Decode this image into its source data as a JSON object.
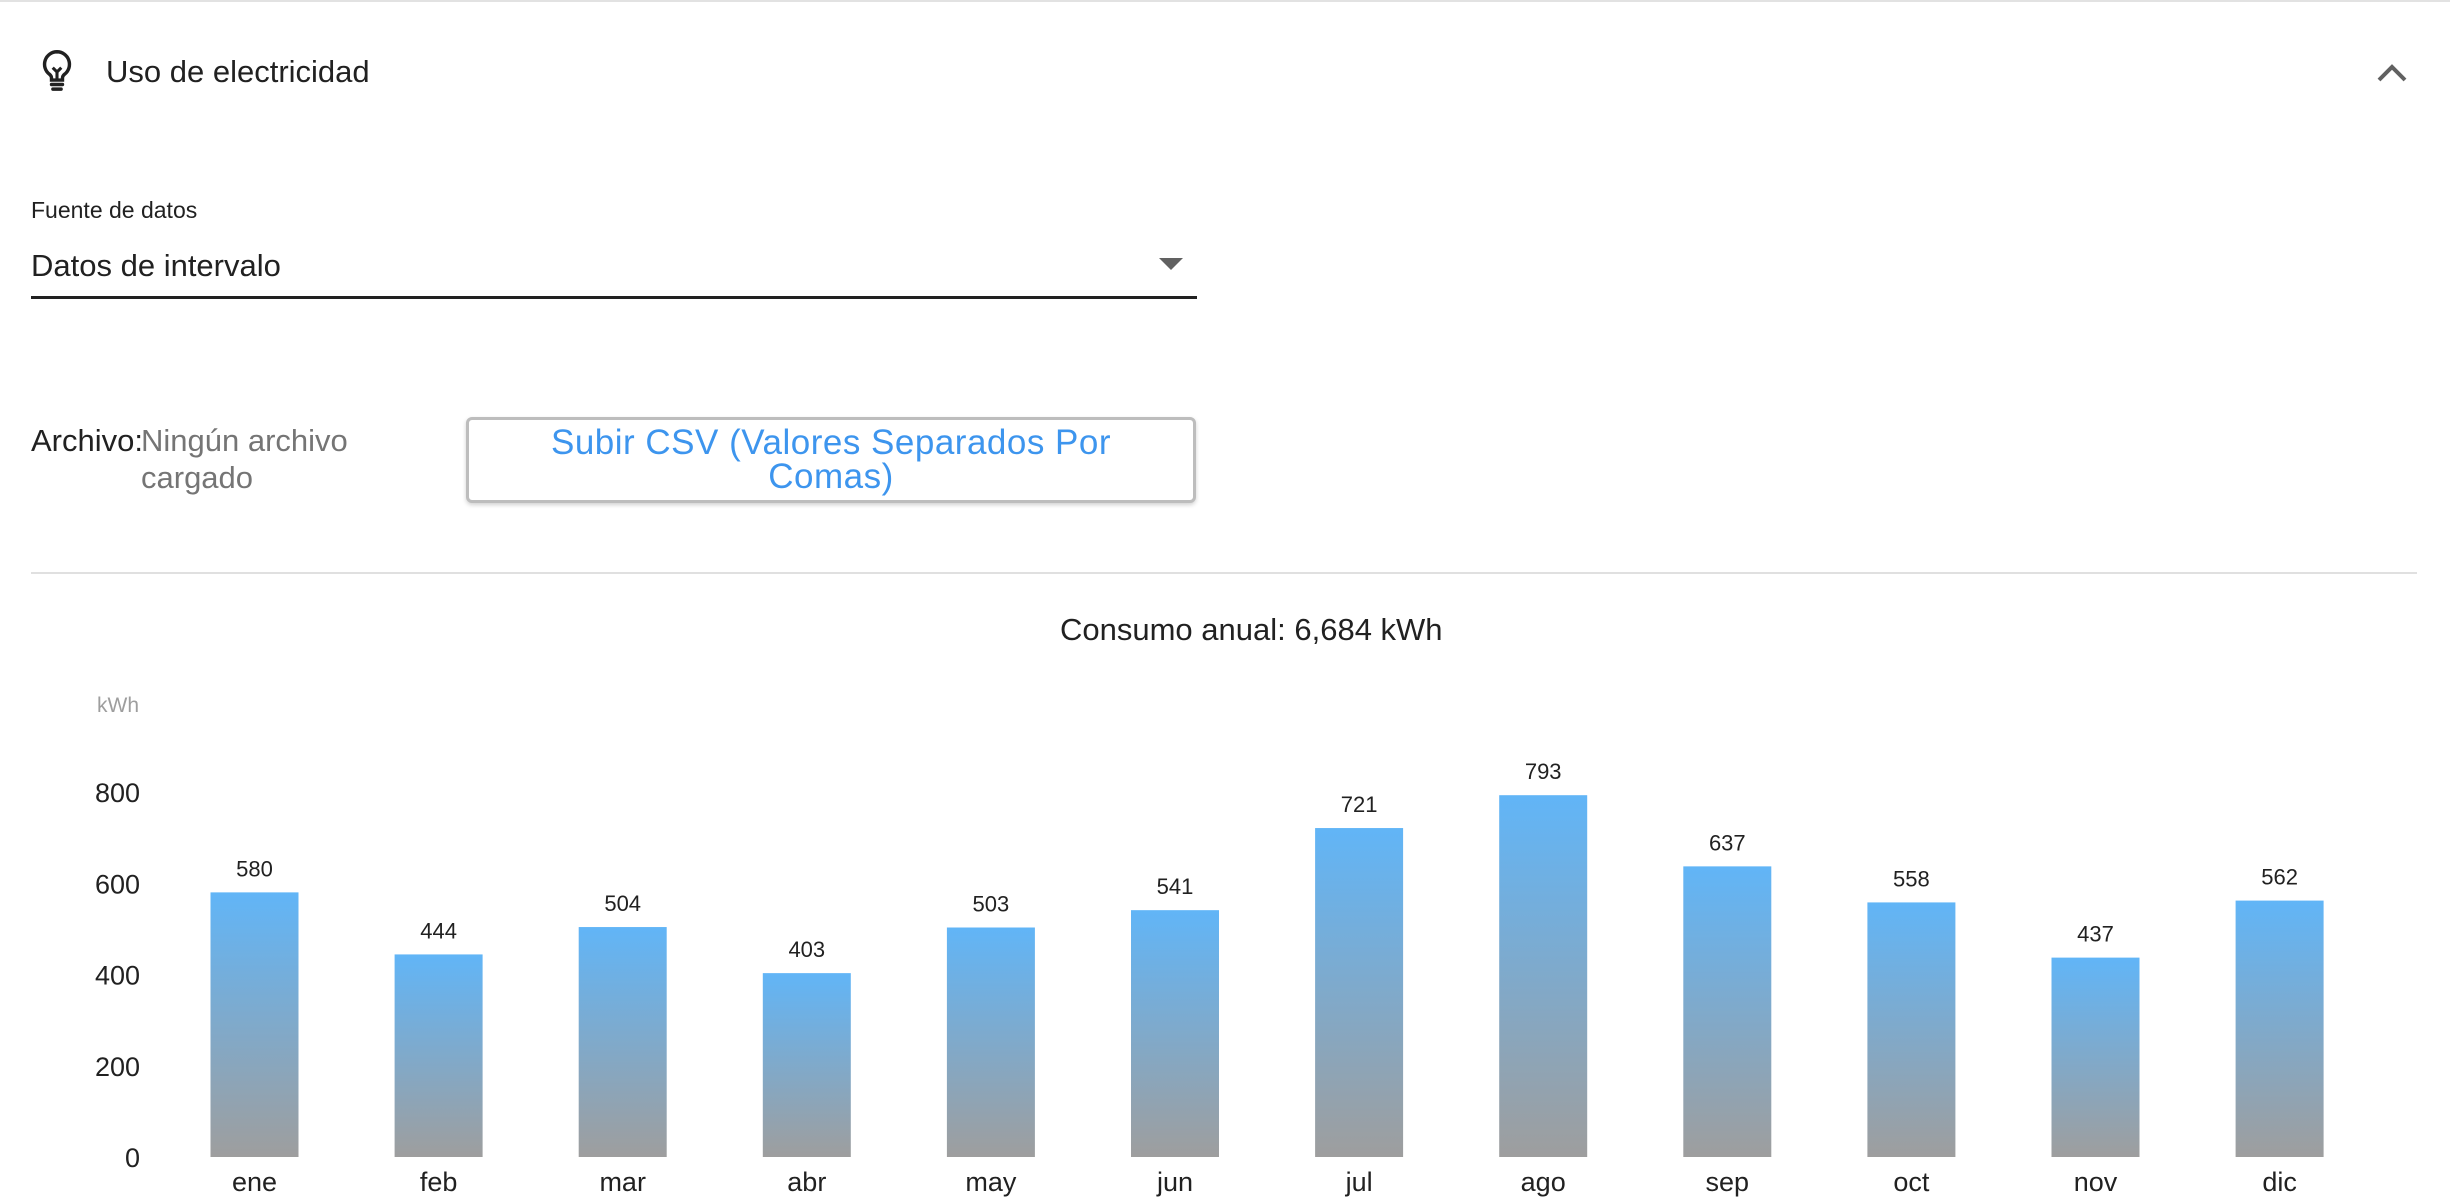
{
  "header": {
    "title": "Uso de electricidad",
    "icon": "lightbulb-icon",
    "collapse_icon": "chevron-up-icon"
  },
  "data_source": {
    "label": "Fuente de datos",
    "selected": "Datos de intervalo"
  },
  "file": {
    "label": "Archivo:",
    "status": "Ningún archivo cargado",
    "upload_button": "Subir CSV (Valores Separados Por Comas)"
  },
  "summary": {
    "annual_consumption": "Consumo anual: 6,684 kWh"
  },
  "colors": {
    "accent": "#3d95ee",
    "bar_top": "#61b5f7",
    "bar_bottom": "#9e9e9e"
  },
  "chart_data": {
    "type": "bar",
    "ylabel": "kWh",
    "categories": [
      "ene",
      "feb",
      "mar",
      "abr",
      "may",
      "jun",
      "jul",
      "ago",
      "sep",
      "oct",
      "nov",
      "dic"
    ],
    "values": [
      580,
      444,
      504,
      403,
      503,
      541,
      721,
      793,
      637,
      558,
      437,
      562
    ],
    "yticks": [
      0,
      200,
      400,
      600,
      800
    ],
    "ylim": [
      0,
      800
    ],
    "data_labels": true,
    "grid": false
  }
}
